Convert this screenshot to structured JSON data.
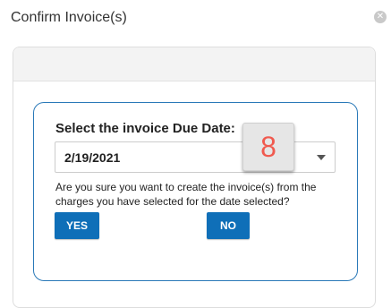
{
  "dialog": {
    "title": "Confirm Invoice(s)",
    "close_icon": "close-icon"
  },
  "form": {
    "due_date_label": "Select the invoice Due Date:",
    "due_date_value": "2/19/2021",
    "badge_number": "8",
    "confirm_text": "Are you sure you want to create the invoice(s) from the charges you have selected for the date selected?",
    "yes_label": "YES",
    "no_label": "NO"
  },
  "colors": {
    "primary": "#0f6fb8",
    "border_accent": "#2a79b8",
    "badge_text": "#f05a4f"
  }
}
